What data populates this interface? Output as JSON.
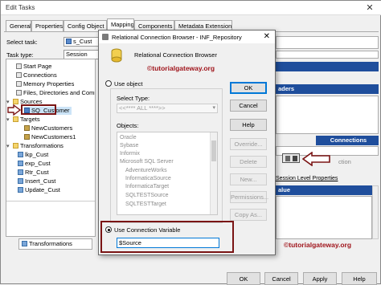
{
  "window": {
    "title": "Edit Tasks",
    "close_glyph": "✕"
  },
  "tabs": [
    "General",
    "Properties",
    "Config Object",
    "Mapping",
    "Components",
    "Metadata Extensions"
  ],
  "active_tab": "Mapping",
  "select_task": {
    "label": "Select task:",
    "value": "s_Cust"
  },
  "task_type": {
    "label": "Task type:",
    "value": "Session"
  },
  "tree": {
    "nodes": [
      {
        "label": "Start Page",
        "icon": "page-icon"
      },
      {
        "label": "Connections",
        "icon": "page-icon"
      },
      {
        "label": "Memory Properties",
        "icon": "page-icon"
      },
      {
        "label": "Files, Directories and Commands",
        "icon": "page-icon"
      },
      {
        "label": "Sources",
        "icon": "folder-icon"
      },
      {
        "label": "SQ_Customer",
        "icon": "source-qualifier-icon"
      },
      {
        "label": "Targets",
        "icon": "folder-icon"
      },
      {
        "label": "NewCustomers",
        "icon": "target-icon"
      },
      {
        "label": "NewCustomers1",
        "icon": "target-icon"
      },
      {
        "label": "Transformations",
        "icon": "folder-icon"
      },
      {
        "label": "lkp_Cust",
        "icon": "transformation-icon"
      },
      {
        "label": "exp_Cust",
        "icon": "transformation-icon"
      },
      {
        "label": "Rtr_Cust",
        "icon": "transformation-icon"
      },
      {
        "label": "Insert_Cust",
        "icon": "transformation-icon"
      },
      {
        "label": "Update_Cust",
        "icon": "transformation-icon"
      }
    ],
    "bottom_tab": "Transformations"
  },
  "right_panel": {
    "readers_header": "aders",
    "connections_header": "Connections",
    "session_link": "Session Level Properties",
    "value_header": "alue",
    "session_text": "ction"
  },
  "dialog": {
    "title": "Relational Connection Browser - INF_Repository",
    "subtitle": "Relational Connection Browser",
    "use_object_label": "Use object",
    "select_type_label": "Select Type:",
    "select_type_value": "<<**** ALL ****>>",
    "objects_label": "Objects:",
    "objects": [
      "Oracle",
      "Sybase",
      "Informix",
      "Microsoft SQL Server",
      "AdventureWorks",
      "InformaticaSource",
      "InformaticaTarget",
      "SQLTESTSource",
      "SQLTESTTarget"
    ],
    "buttons": {
      "ok": "OK",
      "cancel": "Cancel",
      "help": "Help",
      "override": "Override...",
      "delete": "Delete",
      "new": "New...",
      "permissions": "Permissions...",
      "copy_as": "Copy As..."
    },
    "use_conn_var_label": "Use Connection Variable",
    "conn_var_value": "$Source"
  },
  "bottom_buttons": {
    "ok": "OK",
    "cancel": "Cancel",
    "apply": "Apply",
    "help": "Help"
  },
  "watermark": "©tutorialgateway.org",
  "colors": {
    "accent_red": "#a0151c",
    "header_blue": "#1f4e9c",
    "selection": "#cce4f7"
  }
}
